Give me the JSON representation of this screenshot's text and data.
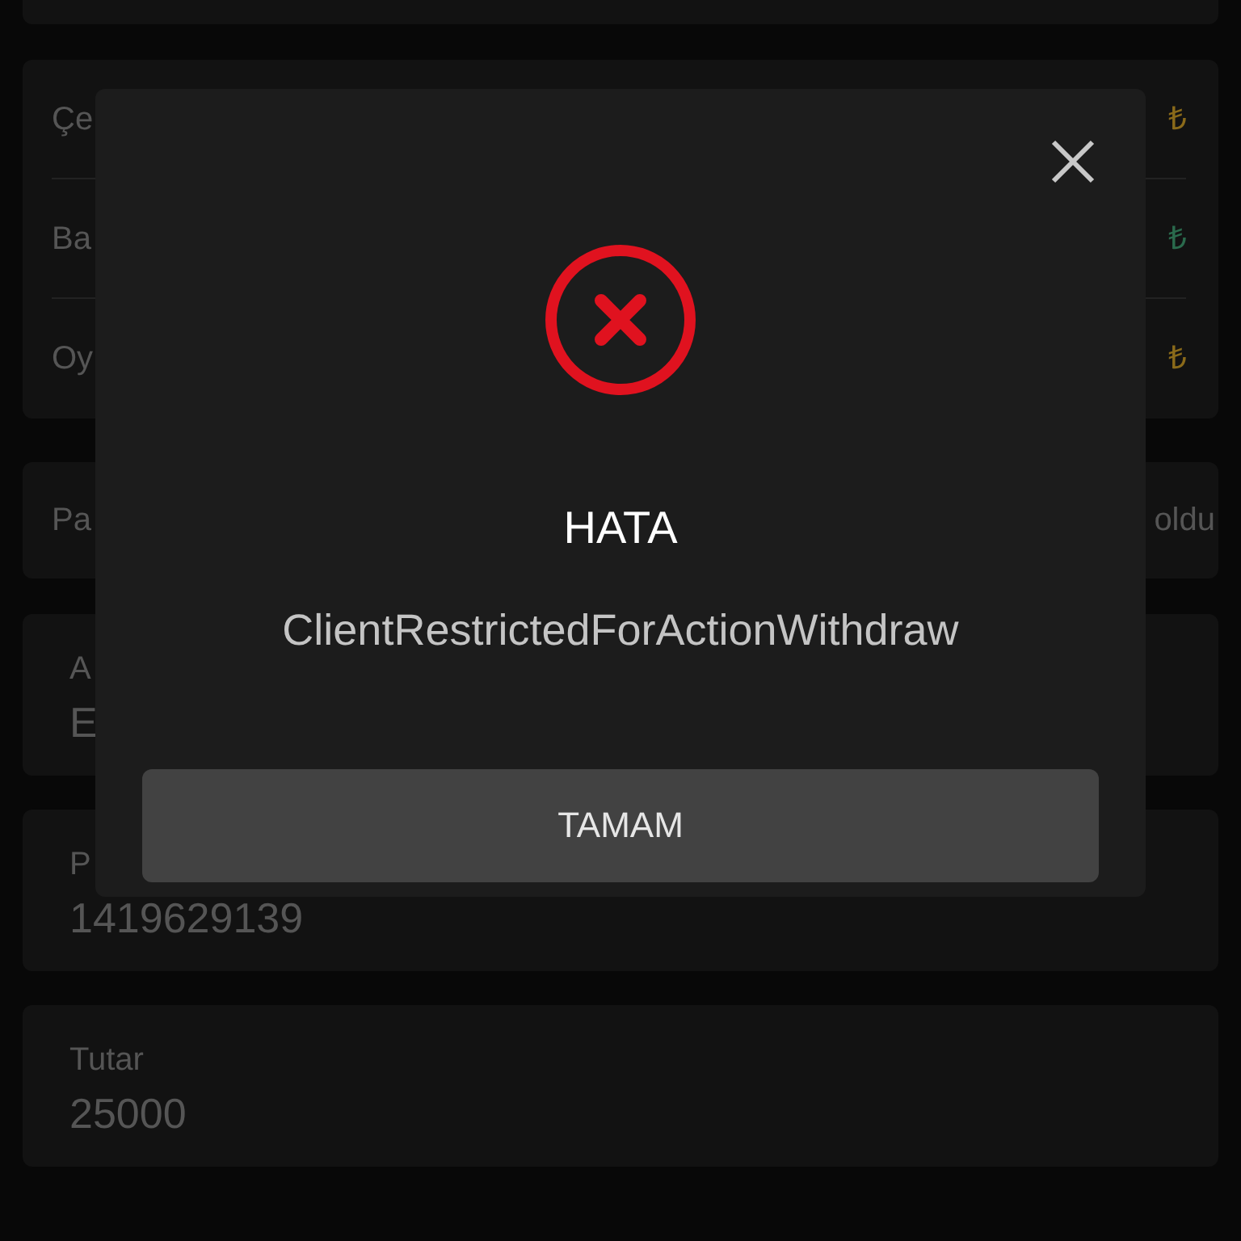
{
  "background": {
    "balance_rows": [
      {
        "label": "Çe",
        "amount": "₺",
        "color": "#8a6a1a"
      },
      {
        "label": "Ba",
        "amount": "₺",
        "color": "#2a6a4c"
      },
      {
        "label": "Oy",
        "amount": "₺",
        "color": "#8a6a1a"
      }
    ],
    "payment_row": {
      "left": "Pa",
      "right": "oldu"
    },
    "fields": [
      {
        "label": "A",
        "value": "E"
      },
      {
        "label": "P",
        "value": "1419629139"
      },
      {
        "label": "Tutar",
        "value": "25000"
      }
    ]
  },
  "dialog": {
    "title": "HATA",
    "message": "ClientRestrictedForActionWithdraw",
    "button": "TAMAM"
  }
}
